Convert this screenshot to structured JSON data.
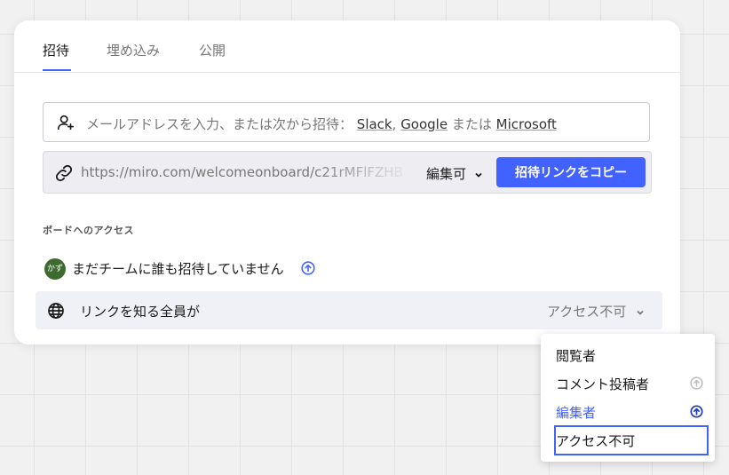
{
  "tabs": [
    {
      "label": "招待"
    },
    {
      "label": "埋め込み"
    },
    {
      "label": "公開"
    }
  ],
  "invite": {
    "prompt": "メールアドレスを入力、または次から招待：",
    "provider_slack": "Slack",
    "comma": ",",
    "provider_google": "Google",
    "or": "または",
    "provider_microsoft": "Microsoft"
  },
  "share_link": {
    "url": "https://miro.com/welcomeonboard/c21rMFlFZHB",
    "permission": "編集可",
    "copy_button": "招待リンクをコピー"
  },
  "access_section": {
    "title": "ボードへのアクセス",
    "team": {
      "avatar_text": "かず",
      "text": "まだチームに誰も招待していません"
    },
    "link_access": {
      "label": "リンクを知る全員が",
      "value": "アクセス不可"
    }
  },
  "dropdown": {
    "items": [
      {
        "label": "閲覧者"
      },
      {
        "label": "コメント投稿者"
      },
      {
        "label": "編集者"
      },
      {
        "label": "アクセス不可"
      }
    ]
  },
  "colors": {
    "accent": "#4262ff",
    "avatar": "#3d6b2f"
  }
}
